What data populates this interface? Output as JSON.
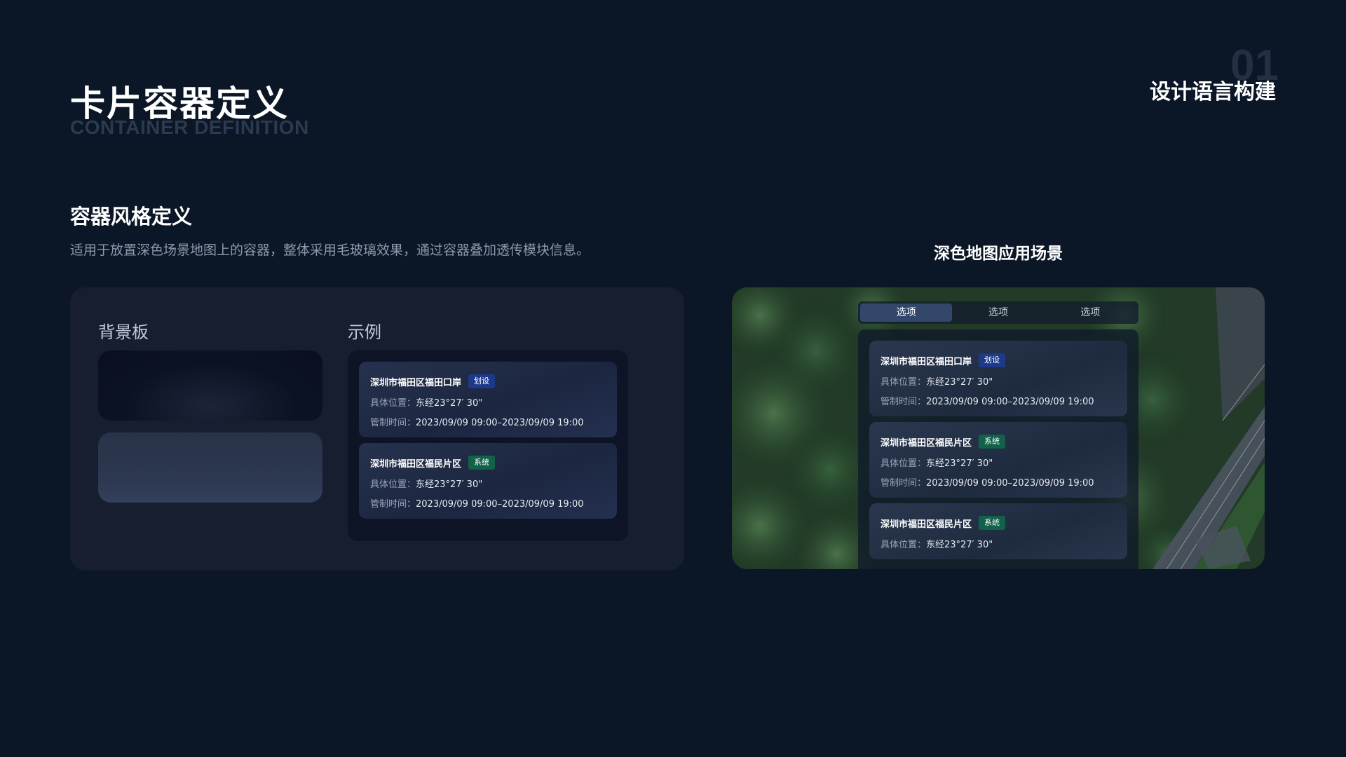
{
  "header": {
    "title": "卡片容器定义",
    "subtitle_en": "CONTAINER DEFINITION",
    "page_number": "01",
    "chapter": "设计语言构建"
  },
  "section": {
    "title": "容器风格定义",
    "description": "适用于放置深色场景地图上的容器，整体采用毛玻璃效果，通过容器叠加透传模块信息。"
  },
  "demo": {
    "background_label": "背景板",
    "example_label": "示例",
    "cards": [
      {
        "title": "深圳市福田区福田口岸",
        "tag": "划设",
        "tag_color": "#1d3a8a",
        "location_key": "具体位置：",
        "location": "东经23°27′ 30\"",
        "time_key": "管制时间：",
        "time": "2023/09/09 09:00–2023/09/09 19:00"
      },
      {
        "title": "深圳市福田区福民片区",
        "tag": "系统",
        "tag_color": "#12614a",
        "location_key": "具体位置：",
        "location": "东经23°27′ 30\"",
        "time_key": "管制时间：",
        "time": "2023/09/09 09:00–2023/09/09 19:00"
      }
    ]
  },
  "scene": {
    "title": "深色地图应用场景",
    "tabs": [
      {
        "label": "选项",
        "active": true
      },
      {
        "label": "选项",
        "active": false
      },
      {
        "label": "选项",
        "active": false
      }
    ],
    "cards": [
      {
        "title": "深圳市福田区福田口岸",
        "tag": "划设",
        "location_key": "具体位置：",
        "location": "东经23°27′ 30\"",
        "time_key": "管制时间：",
        "time": "2023/09/09 09:00–2023/09/09 19:00"
      },
      {
        "title": "深圳市福田区福民片区",
        "tag": "系统",
        "location_key": "具体位置：",
        "location": "东经23°27′ 30\"",
        "time_key": "管制时间：",
        "time": "2023/09/09 09:00–2023/09/09 19:00"
      },
      {
        "title": "深圳市福田区福民片区",
        "tag": "系统",
        "location_key": "具体位置：",
        "location": "东经23°27′ 30\""
      }
    ]
  },
  "colors": {
    "background": "#0b1626",
    "panel": "#171e30",
    "tag_blue": "#1d3a8a",
    "tag_green": "#12614a",
    "muted_text": "#8d99ab"
  }
}
